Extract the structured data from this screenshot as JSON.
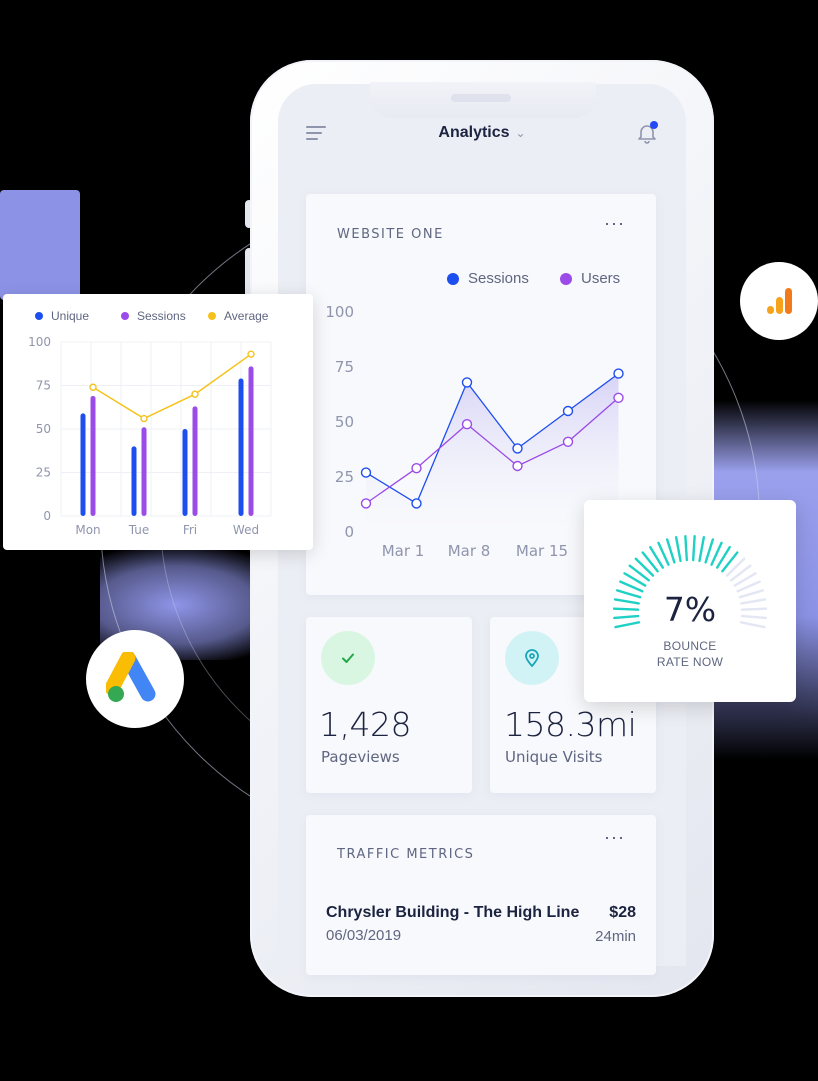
{
  "header": {
    "title": "Analytics"
  },
  "website_card": {
    "title": "WEBSITE ONE",
    "more_label": "···"
  },
  "stats": [
    {
      "value": "1,428",
      "label": "Pageviews",
      "icon": "check-icon",
      "color": "#22a845",
      "bg": "#d9f6e2"
    },
    {
      "value": "158.3mi",
      "label": "Unique Visits",
      "icon": "location-pin-icon",
      "color": "#1aa6b7",
      "bg": "#d2f3f6"
    }
  ],
  "traffic": {
    "title": "TRAFFIC METRICS",
    "more_label": "···",
    "row": {
      "name": "Chrysler Building - The High Line",
      "date": "06/03/2019",
      "amount": "$28",
      "duration": "24min"
    }
  },
  "bounce": {
    "value": "7%",
    "label_line1": "BOUNCE",
    "label_line2": "RATE NOW",
    "fraction": 0.72,
    "color": "#1fd1c4"
  },
  "badges": {
    "left": "google-ads-icon",
    "right": "google-analytics-icon"
  },
  "chart_data": [
    {
      "type": "line",
      "x": [
        "",
        "Mar 1",
        "Mar 8",
        "Mar 15",
        ""
      ],
      "xticks": [
        "Mar 1",
        "Mar 8",
        "Mar 15"
      ],
      "yticks": [
        "0",
        "25",
        "50",
        "75",
        "100"
      ],
      "ylim": [
        0,
        100
      ],
      "legend": "top-right",
      "series": [
        {
          "name": "Sessions",
          "color": "#1d4ef0",
          "values": [
            27,
            13,
            68,
            38,
            55,
            72
          ]
        },
        {
          "name": "Users",
          "color": "#9b4be8",
          "values": [
            13,
            29,
            49,
            30,
            41,
            61
          ]
        }
      ],
      "area": true
    },
    {
      "type": "bar",
      "categories": [
        "Mon",
        "Tue",
        "Fri",
        "Wed"
      ],
      "yticks": [
        "0",
        "25",
        "50",
        "75",
        "100"
      ],
      "ylim": [
        0,
        100
      ],
      "legend": "top",
      "series": [
        {
          "name": "Unique",
          "color": "#1d4ef0",
          "values": [
            59,
            40,
            50,
            79
          ]
        },
        {
          "name": "Sessions",
          "color": "#9b4be8",
          "values": [
            69,
            51,
            63,
            86
          ]
        },
        {
          "name": "Average",
          "color": "#f5c21b",
          "values": [
            74,
            56,
            70,
            93
          ],
          "kind": "line"
        }
      ],
      "grid": true
    }
  ]
}
